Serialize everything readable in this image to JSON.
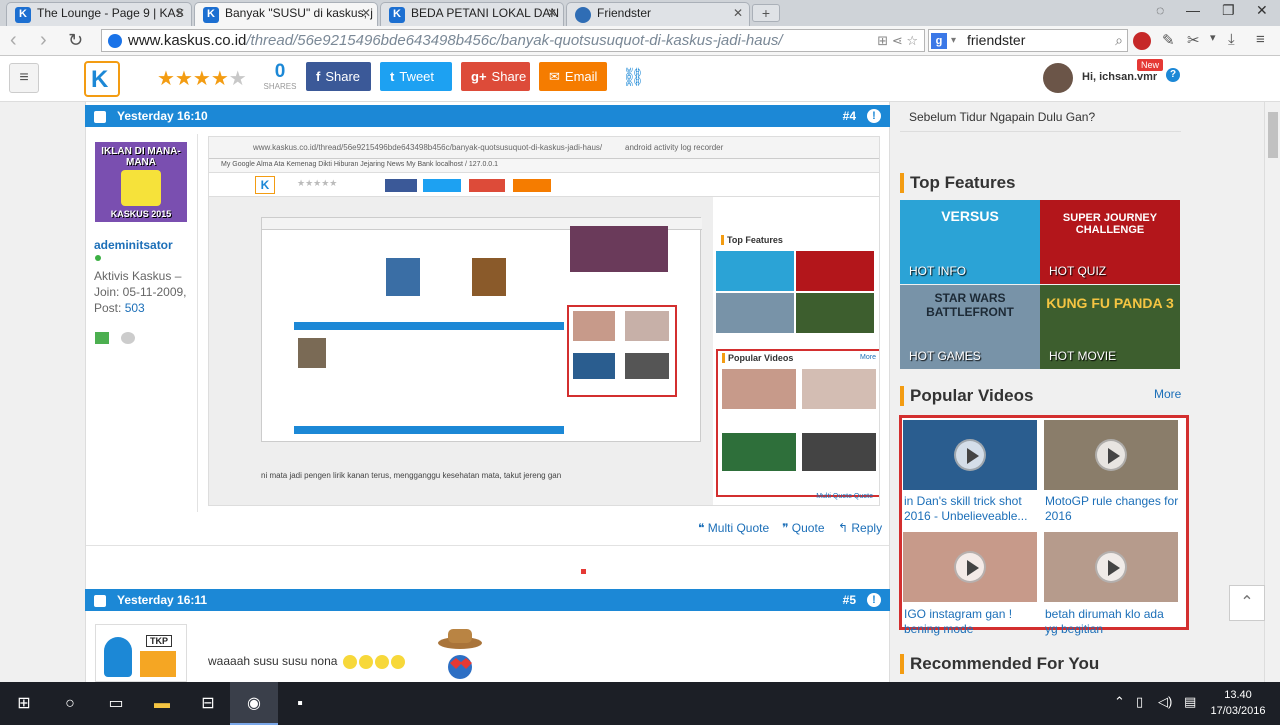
{
  "browser": {
    "tabs": [
      {
        "title": "The Lounge - Page 9 | KAS",
        "active": false
      },
      {
        "title": "Banyak \"SUSU\" di kaskus, j",
        "active": true
      },
      {
        "title": "BEDA PETANI LOKAL DAN",
        "active": false
      },
      {
        "title": "Friendster",
        "active": false
      }
    ],
    "url_domain": "www.kaskus.co.id",
    "url_path": "/thread/56e9215496bde643498b456c/banyak-quotsusuquot-di-kaskus-jadi-haus/",
    "search_value": "friendster",
    "search_engine": "g"
  },
  "header": {
    "logo": "K",
    "rating_filled": 4,
    "rating_total": 5,
    "shares_count": "0",
    "shares_label": "SHARES",
    "share_buttons": [
      {
        "icon": "f",
        "label": "Share",
        "color": "#3b5998"
      },
      {
        "icon": "t",
        "label": "Tweet",
        "color": "#1da1f2"
      },
      {
        "icon": "g+",
        "label": "Share",
        "color": "#dd4b39"
      },
      {
        "icon": "✉",
        "label": "Email",
        "color": "#f57c00"
      }
    ],
    "greeting": "Hi, ichsan.vmr",
    "new_badge": "New"
  },
  "post4": {
    "time": "Yesterday 16:10",
    "number": "#4",
    "user": {
      "avatar_top": "IKLAN DI MANA-MANA",
      "avatar_bottom": "KASKUS 2015",
      "name": "ademinitsator",
      "rank": "Aktivis Kaskus",
      "join": "Join: 05-11-2009,",
      "post_label": "Post:",
      "post_count": "503"
    },
    "embedded": {
      "url": "www.kaskus.co.id/thread/56e9215496bde643498b456c/banyak-quotsusuquot-di-kaskus-jadi-haus/",
      "search": "android activity log recorder",
      "bookmarks": "My Google   Alma Ata   Kemenag   Dikti   Hiburan   Jejaring   News   My Bank   localhost / 127.0.0.1",
      "right_top_features": "Top Features",
      "right_popular": "Popular Videos",
      "right_more": "More",
      "caption": "ni mata jadi pengen lirik kanan terus, mengganggu kesehatan mata, takut jereng gan",
      "actions": "Multi Quote   Quote"
    },
    "actions": {
      "multi_quote": "Multi Quote",
      "quote": "Quote",
      "reply": "Reply"
    }
  },
  "post5": {
    "time": "Yesterday 16:11",
    "number": "#5",
    "avatar_label": "TKP",
    "text": "waaaah susu susu nona"
  },
  "sidebar": {
    "prev_link": "Sebelum Tidur Ngapain Dulu Gan?",
    "top_features_title": "Top Features",
    "features": [
      {
        "label": "HOT INFO",
        "art": "VERSUS",
        "color": "#2ba3d6"
      },
      {
        "label": "HOT QUIZ",
        "art": "SUPER JOURNEY CHALLENGE",
        "color": "#b3161b"
      },
      {
        "label": "HOT GAMES",
        "art": "STAR WARS BATTLEFRONT",
        "color": "#7893a8"
      },
      {
        "label": "HOT MOVIE",
        "art": "KUNG FU PANDA 3",
        "color": "#3d5e2e"
      }
    ],
    "popular_videos_title": "Popular Videos",
    "popular_more": "More",
    "videos": [
      {
        "title": "in Dan's skill trick shot 2016 - Unbelieveable...",
        "color": "#2a5d8f"
      },
      {
        "title": "MotoGP rule changes for 2016",
        "color": "#8a7d6a"
      },
      {
        "title": "IGO instagram gan ! bening mode",
        "color": "#c79a8a"
      },
      {
        "title": "betah dirumah klo ada yg begitian",
        "color": "#b69b8c"
      }
    ],
    "recommended_title": "Recommended For You"
  },
  "taskbar": {
    "time": "13.40",
    "date": "17/03/2016"
  }
}
